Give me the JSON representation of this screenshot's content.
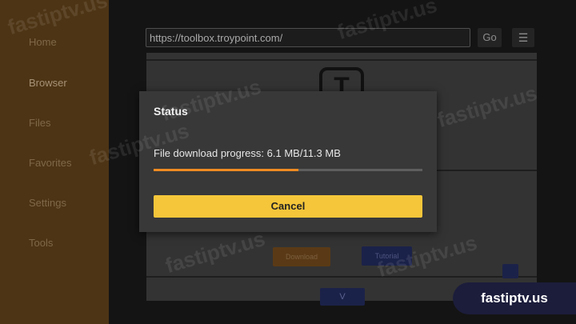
{
  "sidebar": {
    "items": [
      {
        "label": "Home"
      },
      {
        "label": "Browser"
      },
      {
        "label": "Files"
      },
      {
        "label": "Favorites"
      },
      {
        "label": "Settings"
      },
      {
        "label": "Tools"
      }
    ],
    "active_index": 1
  },
  "browser": {
    "url": "https://toolbox.troypoint.com/",
    "go_label": "Go",
    "menu_icon": "menu-icon",
    "logo_letter": "T",
    "page_buttons": [
      "Download",
      "Tutorial"
    ],
    "bottom_button": "V"
  },
  "dialog": {
    "title": "Status",
    "progress_text": "File download progress: 6.1 MB/11.3 MB",
    "progress_fraction": 0.54,
    "cancel_label": "Cancel",
    "colors": {
      "progress": "#ef8b22",
      "cancel_button": "#f5c63a"
    }
  },
  "watermark": "fastiptv.us",
  "badge": {
    "label": "fastiptv.us"
  }
}
